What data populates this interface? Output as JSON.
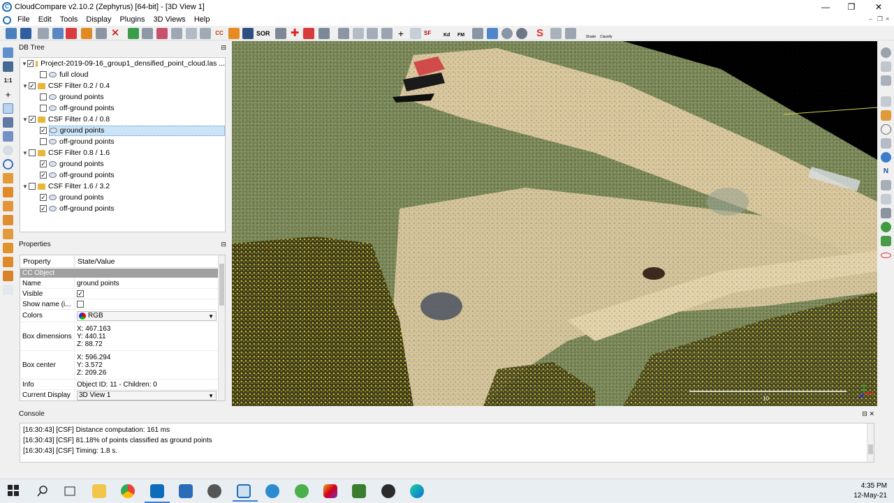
{
  "window": {
    "title": "CloudCompare v2.10.2 (Zephyrus) [64-bit] - [3D View 1]",
    "minimize_label": "—",
    "maximize_label": "❐",
    "close_label": "✕"
  },
  "menu": {
    "items": [
      "File",
      "Edit",
      "Tools",
      "Display",
      "Plugins",
      "3D Views",
      "Help"
    ],
    "mdi_controls": [
      "–",
      "❐",
      "×"
    ]
  },
  "toolbar": {
    "sor_label": "SOR",
    "sf_label": "SF",
    "kd_label": "Kd",
    "fm_label": "FM",
    "classify_label": "Classify",
    "shade_label": "Shade"
  },
  "db_tree": {
    "title": "DB Tree",
    "pin": "⊟",
    "rows": [
      {
        "label": "Project-2019-09-16_group1_densified_point_cloud.las ...",
        "type": "folder",
        "checked": true,
        "expander": "▼"
      },
      {
        "label": "full cloud",
        "type": "cloud",
        "checked": false,
        "expander": ""
      },
      {
        "label": "CSF Filter 0.2 / 0.4",
        "type": "folder",
        "checked": true,
        "expander": "▼"
      },
      {
        "label": "ground points",
        "type": "cloud",
        "checked": false,
        "expander": ""
      },
      {
        "label": "off-ground points",
        "type": "cloud",
        "checked": false,
        "expander": ""
      },
      {
        "label": "CSF Filter 0.4 / 0.8",
        "type": "folder",
        "checked": true,
        "expander": "▼"
      },
      {
        "label": "ground points",
        "type": "cloud",
        "checked": true,
        "expander": "",
        "selected": true
      },
      {
        "label": "off-ground points",
        "type": "cloud",
        "checked": false,
        "expander": ""
      },
      {
        "label": "CSF Filter 0.8 / 1.6",
        "type": "folder",
        "checked": false,
        "expander": "▼"
      },
      {
        "label": "ground points",
        "type": "cloud",
        "checked": true,
        "expander": ""
      },
      {
        "label": "off-ground points",
        "type": "cloud",
        "checked": true,
        "expander": ""
      },
      {
        "label": "CSF Filter 1.6 / 3.2",
        "type": "folder",
        "checked": false,
        "expander": "▼"
      },
      {
        "label": "ground points",
        "type": "cloud",
        "checked": true,
        "expander": ""
      },
      {
        "label": "off-ground points",
        "type": "cloud",
        "checked": true,
        "expander": ""
      }
    ]
  },
  "properties": {
    "title": "Properties",
    "pin": "⊟",
    "col_property": "Property",
    "col_value": "State/Value",
    "section": "CC Object",
    "name_key": "Name",
    "name_value": "ground points",
    "visible_key": "Visible",
    "visible_checked": true,
    "showname_key": "Show name (i...",
    "showname_checked": false,
    "colors_key": "Colors",
    "colors_value": "RGB",
    "boxdim_key": "Box dimensions",
    "boxdim_x": "X: 467.163",
    "boxdim_y": "Y: 440.11",
    "boxdim_z": "Z: 88.72",
    "boxcenter_key": "Box center",
    "boxcenter_x": "X: 596.294",
    "boxcenter_y": "Y: 3.572",
    "boxcenter_z": "Z: 209.26",
    "info_key": "Info",
    "info_value": "Object ID: 11 - Children: 0",
    "display_key": "Current Display",
    "display_value": "3D View 1"
  },
  "console": {
    "title": "Console",
    "controls": "⊟ ✕",
    "lines": [
      "[16:30:43] [CSF] Distance computation: 161 ms",
      "[16:30:43] [CSF] 81.18% of points classified as ground points",
      "[16:30:43] [CSF] Timing: 1.8 s."
    ]
  },
  "view": {
    "scale_label": "10"
  },
  "taskbar": {
    "time": "4:35 PM",
    "date": "12-May-21"
  },
  "colors": {
    "accent": "#3a7bd5",
    "selection": "#cce4f7",
    "folder": "#e7b63c",
    "section_bg": "#a0a0a0"
  }
}
